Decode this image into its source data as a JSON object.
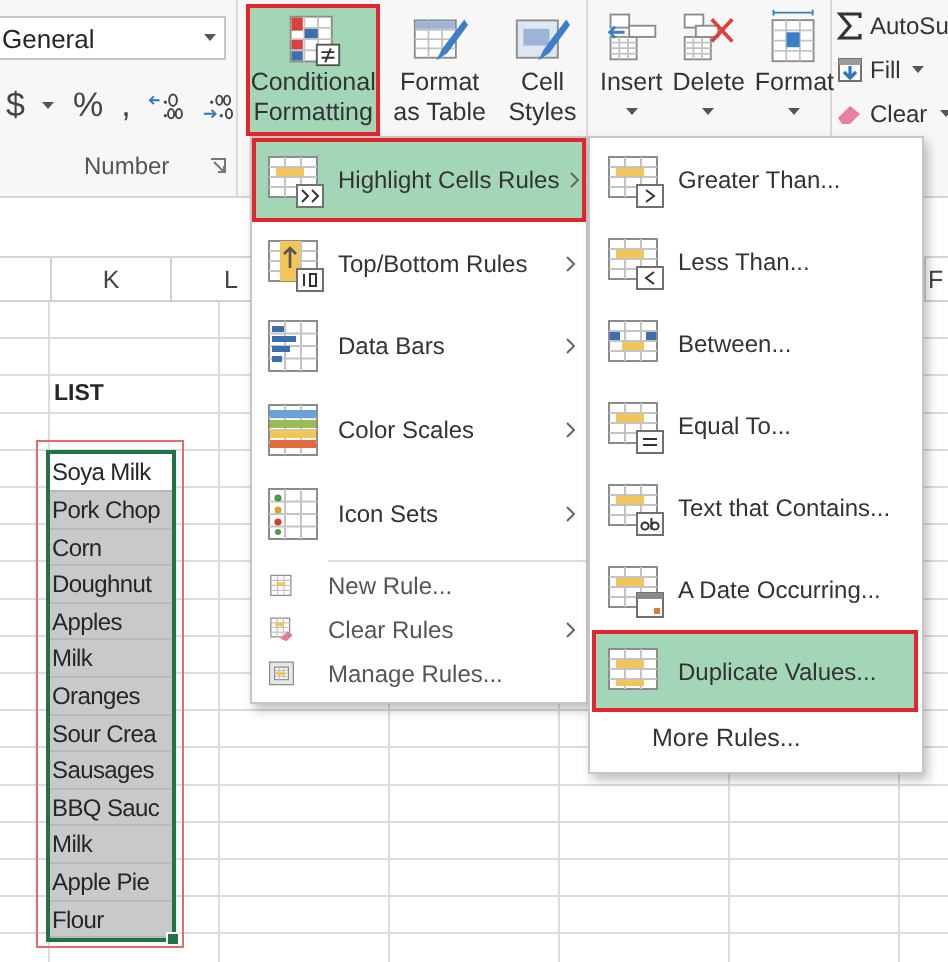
{
  "ribbon": {
    "number_group": {
      "format_field": {
        "value": "General"
      },
      "format_buttons": [
        {
          "label": "$",
          "kind": "currency"
        },
        {
          "label": "%",
          "kind": "percent"
        },
        {
          "label": ",",
          "kind": "comma"
        }
      ],
      "label": "Number"
    },
    "styles_group": {
      "buttons": [
        {
          "label": "Conditional Formatting",
          "kind": "conditional",
          "selected": true
        },
        {
          "label": "Format as Table",
          "kind": "format_table",
          "selected": false
        },
        {
          "label": "Cell Styles",
          "kind": "cell_styles",
          "selected": false
        }
      ]
    },
    "cells_group": {
      "buttons": [
        {
          "label": "Insert",
          "kind": "insert"
        },
        {
          "label": "Delete",
          "kind": "delete"
        },
        {
          "label": "Format",
          "kind": "format"
        }
      ]
    },
    "editing_group": {
      "buttons": [
        {
          "label": "AutoSu",
          "kind": "autosum"
        },
        {
          "label": "Fill",
          "kind": "fill"
        },
        {
          "label": "Clear",
          "kind": "clear"
        }
      ]
    }
  },
  "sheet": {
    "columns": [
      {
        "label": "K"
      },
      {
        "label": "L"
      }
    ],
    "edge_column": {
      "label": "F"
    },
    "heading": "LIST",
    "list": [
      {
        "text": "Soya Milk",
        "active": true
      },
      {
        "text": "Pork Chop",
        "active": false
      },
      {
        "text": "Corn",
        "active": false
      },
      {
        "text": "Doughnut",
        "active": false
      },
      {
        "text": "Apples",
        "active": false
      },
      {
        "text": "Milk",
        "active": false
      },
      {
        "text": "Oranges",
        "active": false
      },
      {
        "text": "Sour Crea",
        "active": false
      },
      {
        "text": "Sausages",
        "active": false
      },
      {
        "text": "BBQ Sauc",
        "active": false
      },
      {
        "text": "Milk",
        "active": false
      },
      {
        "text": "Apple Pie",
        "active": false
      },
      {
        "text": "Flour",
        "active": false
      }
    ]
  },
  "menu": {
    "items": [
      {
        "label": "Highlight Cells Rules",
        "kind": "highlight",
        "selected": true,
        "has_submenu": true
      },
      {
        "label": "Top/Bottom Rules",
        "kind": "top_bottom",
        "selected": false,
        "has_submenu": true
      },
      {
        "label": "Data Bars",
        "kind": "data_bars",
        "selected": false,
        "has_submenu": true
      },
      {
        "label": "Color Scales",
        "kind": "color_scales",
        "selected": false,
        "has_submenu": true
      },
      {
        "label": "Icon Sets",
        "kind": "icon_sets",
        "selected": false,
        "has_submenu": true
      },
      {
        "label": "New Rule...",
        "kind": "new_rule",
        "selected": false,
        "has_submenu": false
      },
      {
        "label": "Clear Rules",
        "kind": "clear_rules",
        "selected": false,
        "has_submenu": true
      },
      {
        "label": "Manage Rules...",
        "kind": "manage_rules",
        "selected": false,
        "has_submenu": false
      }
    ]
  },
  "submenu": {
    "items": [
      {
        "label": "Greater Than...",
        "kind": "greater",
        "selected": false
      },
      {
        "label": "Less Than...",
        "kind": "less",
        "selected": false
      },
      {
        "label": "Between...",
        "kind": "between",
        "selected": false
      },
      {
        "label": "Equal To...",
        "kind": "equal",
        "selected": false
      },
      {
        "label": "Text that Contains...",
        "kind": "contains",
        "selected": false
      },
      {
        "label": "A Date Occurring...",
        "kind": "date",
        "selected": false
      },
      {
        "label": "Duplicate Values...",
        "kind": "duplicate",
        "selected": true
      },
      {
        "label": "More Rules...",
        "kind": "text",
        "selected": false
      }
    ]
  }
}
